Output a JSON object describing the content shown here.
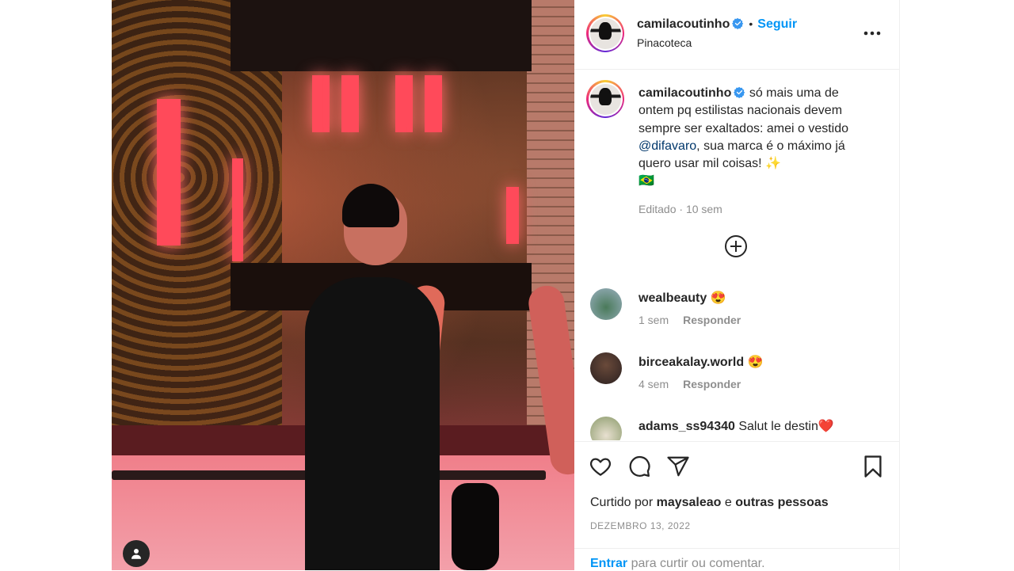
{
  "post": {
    "author": {
      "username": "camilacoutinho",
      "verified": true,
      "follow_label": "Seguir",
      "location": "Pinacoteca"
    },
    "caption": {
      "text_before_mention": "só mais uma de ontem pq estilistas nacionais devem sempre ser exaltados: amei o vestido ",
      "mention": "@difavaro",
      "text_after_mention": ", sua marca é o máximo já quero usar mil coisas! ✨",
      "flag": "🇧🇷",
      "edited_label": "Editado",
      "time": "10 sem"
    },
    "comments": [
      {
        "username": "wealbeauty",
        "text": "😍",
        "time": "1 sem",
        "reply_label": "Responder"
      },
      {
        "username": "birceakalay.world",
        "text": "😍",
        "time": "4 sem",
        "reply_label": "Responder"
      },
      {
        "username": "adams_ss94340",
        "text": "Salut le destin❤️",
        "time": "",
        "reply_label": ""
      }
    ],
    "likes": {
      "prefix": "Curtido por",
      "user": "maysaleao",
      "conjunction": "e",
      "others": "outras pessoas"
    },
    "date": "DEZEMBRO 13, 2022",
    "login_prompt": {
      "link": "Entrar",
      "text": "para curtir ou comentar."
    }
  },
  "icons": {
    "verified": "verified-badge-icon",
    "more": "more-options-icon",
    "load_more": "plus-circle-icon",
    "like": "heart-icon",
    "comment": "comment-icon",
    "share": "send-icon",
    "save": "bookmark-icon",
    "tag": "user-tag-icon"
  },
  "colors": {
    "follow_blue": "#0095f6",
    "mention_blue": "#00376b",
    "muted": "#8e8e8e",
    "text": "#262626"
  }
}
